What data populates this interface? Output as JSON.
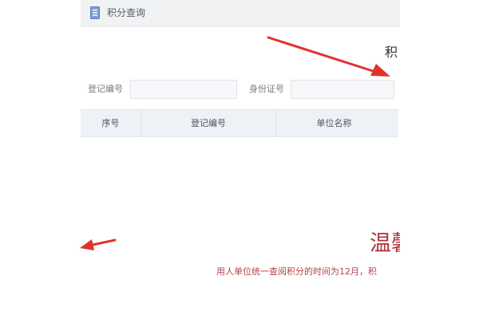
{
  "window": {
    "title": "积分查询"
  },
  "page": {
    "heading_fragment": "积"
  },
  "search_form": {
    "registration_label": "登记编号",
    "registration_value": "",
    "id_card_label": "身份证号",
    "id_card_value": ""
  },
  "table": {
    "columns": [
      "序号",
      "登记编号",
      "单位名称"
    ]
  },
  "notice": {
    "big_text": "温馨",
    "small_text": "用人单位统一查阅积分的时间为12月，积"
  },
  "colors": {
    "notice_red": "#b0323a",
    "arrow_red": "#e0322c"
  },
  "icons": {
    "title": "document-icon"
  }
}
